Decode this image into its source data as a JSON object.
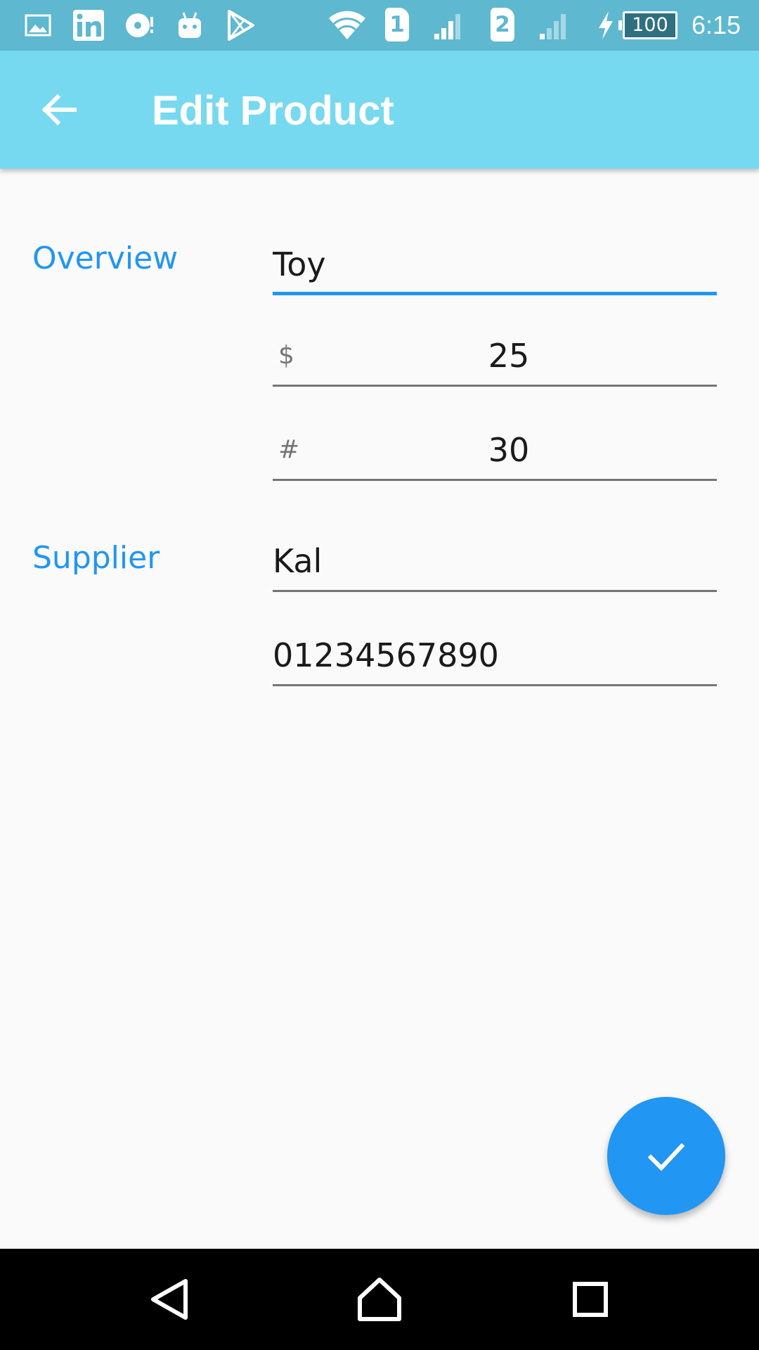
{
  "status_bar": {
    "left_icons": [
      "gallery-icon",
      "linkedin-icon",
      "music-icon",
      "android-icon",
      "play-store-icon"
    ],
    "right_icons": [
      "wifi-icon",
      "sim1-icon",
      "signal1-icon",
      "sim2-icon",
      "signal2-icon",
      "charging-icon",
      "battery-icon"
    ],
    "sim1_label": "1",
    "sim2_label": "2",
    "battery_level": "100",
    "time": "6:15"
  },
  "app_bar": {
    "title": "Edit Product",
    "back_icon": "arrow-back-icon",
    "color": "#76d9f0"
  },
  "form": {
    "overview": {
      "label": "Overview",
      "name_value": "Toy",
      "price_prefix": "$",
      "price_value": "25",
      "quantity_prefix": "#",
      "quantity_value": "30"
    },
    "supplier": {
      "label": "Supplier",
      "name_value": "Kal",
      "phone_value": "01234567890"
    }
  },
  "fab": {
    "icon": "check-icon",
    "color": "#2196f3"
  },
  "nav_bar": {
    "icons": [
      "back-triangle-icon",
      "home-icon",
      "recents-icon"
    ]
  },
  "colors": {
    "accent": "#2196f3",
    "status_bar": "#5eb8cf",
    "background": "#fafafa"
  }
}
